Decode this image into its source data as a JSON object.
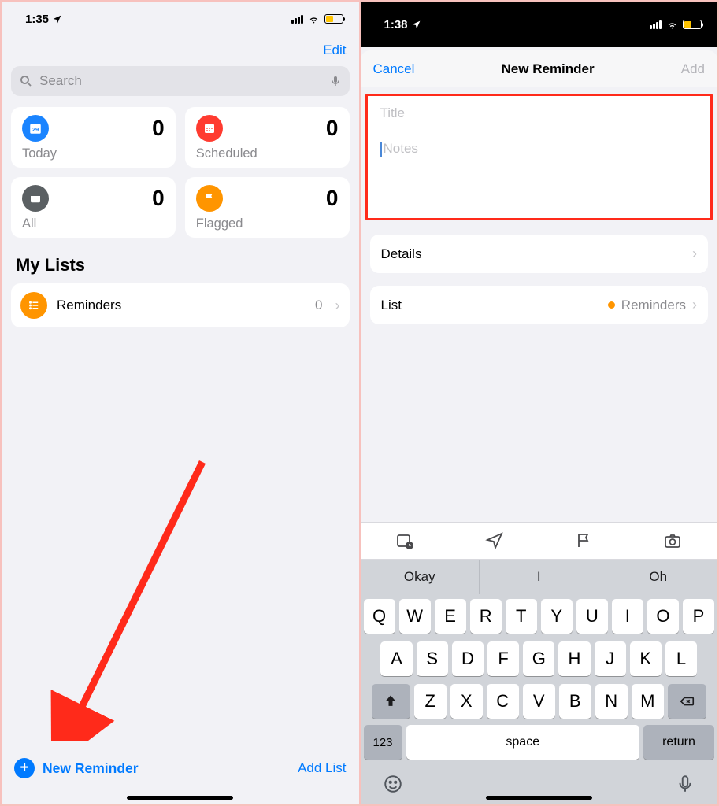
{
  "left": {
    "status": {
      "time": "1:35"
    },
    "edit": "Edit",
    "search": {
      "placeholder": "Search"
    },
    "tiles": {
      "today": {
        "label": "Today",
        "count": "0"
      },
      "scheduled": {
        "label": "Scheduled",
        "count": "0"
      },
      "all": {
        "label": "All",
        "count": "0"
      },
      "flagged": {
        "label": "Flagged",
        "count": "0"
      }
    },
    "myListsTitle": "My Lists",
    "reminders": {
      "label": "Reminders",
      "count": "0"
    },
    "newReminder": "New Reminder",
    "addList": "Add List"
  },
  "right": {
    "status": {
      "time": "1:38"
    },
    "nav": {
      "cancel": "Cancel",
      "title": "New Reminder",
      "add": "Add"
    },
    "form": {
      "titlePlaceholder": "Title",
      "notesPlaceholder": "Notes"
    },
    "details": "Details",
    "list": {
      "label": "List",
      "value": "Reminders"
    },
    "suggestions": [
      "Okay",
      "I",
      "Oh"
    ],
    "keys": {
      "row1": [
        "Q",
        "W",
        "E",
        "R",
        "T",
        "Y",
        "U",
        "I",
        "O",
        "P"
      ],
      "row2": [
        "A",
        "S",
        "D",
        "F",
        "G",
        "H",
        "J",
        "K",
        "L"
      ],
      "row3": [
        "Z",
        "X",
        "C",
        "V",
        "B",
        "N",
        "M"
      ],
      "numKey": "123",
      "space": "space",
      "return": "return"
    }
  }
}
